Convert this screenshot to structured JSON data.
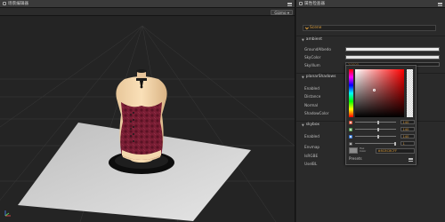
{
  "scene": {
    "tab_label": "场景编辑器",
    "gizmo_label": "Gizmo ▾"
  },
  "inspector": {
    "tab_label": "属性检查器",
    "node_name": "Scene",
    "sections": {
      "ambient": "ambient",
      "planar_shadows": "planarShadows",
      "skybox": "skybox"
    },
    "props": {
      "ground_albedo": "GroundAlbedo",
      "sky_color": "SkyColor",
      "sky_illum": "SkyIllum",
      "sky_illum_value": "20000",
      "enabled_shadows": "Enabled",
      "distance": "Distance",
      "normal": "Normal",
      "shadow_color": "ShadowColor",
      "enabled_skybox": "Enabled",
      "envmap": "Envmap",
      "is_rgbe": "IsRGBE",
      "use_ibl": "UseIBL"
    }
  },
  "color_picker": {
    "r_value": "140",
    "g_value": "140",
    "b_value": "140",
    "a_value": "1",
    "hex_caption_1": "Hex",
    "hex_caption_2": "Color",
    "hex_value": "#8C8C8CFF",
    "presets_label": "Presets",
    "preview_color": "#8c8c8c"
  },
  "icons": [
    "menu-icon",
    "check-icon",
    "chevron-down-icon",
    "axis-gizmo-icon"
  ],
  "colors": {
    "accent": "#d79a3a",
    "panel_bg": "#2a2a2a",
    "scene_bg": "#232323"
  }
}
